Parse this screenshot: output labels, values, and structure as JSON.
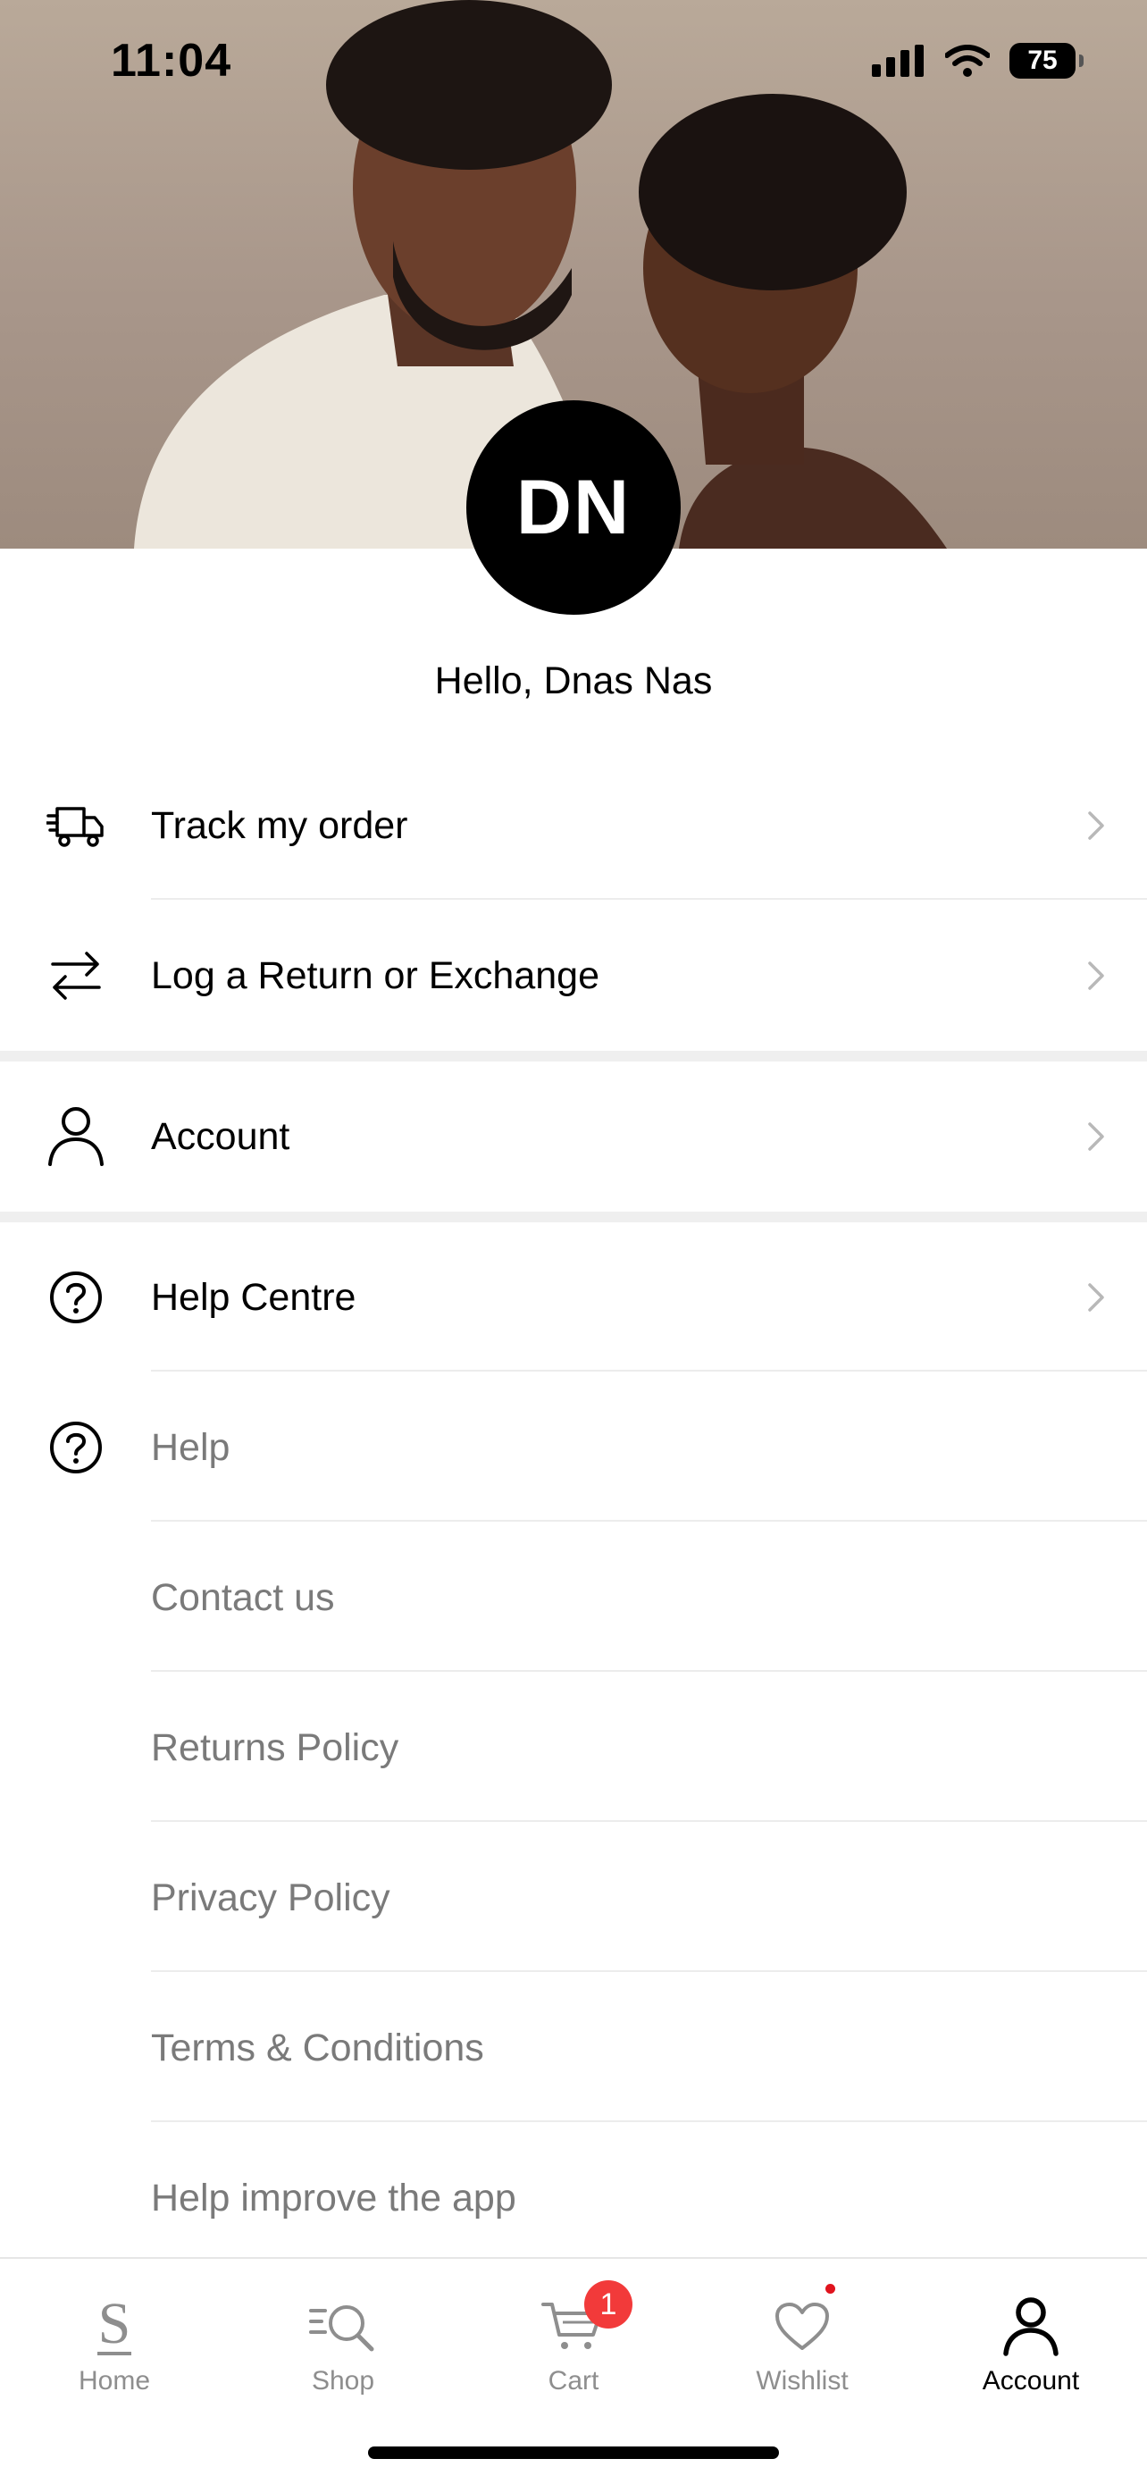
{
  "status_bar": {
    "time": "11:04",
    "battery": "75"
  },
  "profile": {
    "initials": "DN",
    "greeting": "Hello, Dnas Nas"
  },
  "orders_section": [
    {
      "label": "Track my order",
      "icon": "truck-icon"
    },
    {
      "label": "Log a Return or Exchange",
      "icon": "swap-arrows-icon"
    }
  ],
  "account_section": {
    "label": "Account",
    "icon": "person-icon"
  },
  "help_centre": {
    "label": "Help Centre",
    "icon": "question-circle-icon"
  },
  "help_links": [
    {
      "label": "Help",
      "icon": "question-circle-icon"
    },
    {
      "label": "Contact us"
    },
    {
      "label": "Returns Policy"
    },
    {
      "label": "Privacy Policy"
    },
    {
      "label": "Terms & Conditions"
    },
    {
      "label": "Help improve the app"
    }
  ],
  "tabbar": {
    "items": [
      {
        "label": "Home",
        "icon": "brand-s-icon"
      },
      {
        "label": "Shop",
        "icon": "search-list-icon"
      },
      {
        "label": "Cart",
        "icon": "cart-icon",
        "badge": "1"
      },
      {
        "label": "Wishlist",
        "icon": "heart-icon"
      },
      {
        "label": "Account",
        "icon": "person-icon",
        "active": true
      }
    ]
  },
  "colors": {
    "badge": "#f23a3a",
    "accent": "#000000",
    "muted_text": "#7a7a7a"
  }
}
